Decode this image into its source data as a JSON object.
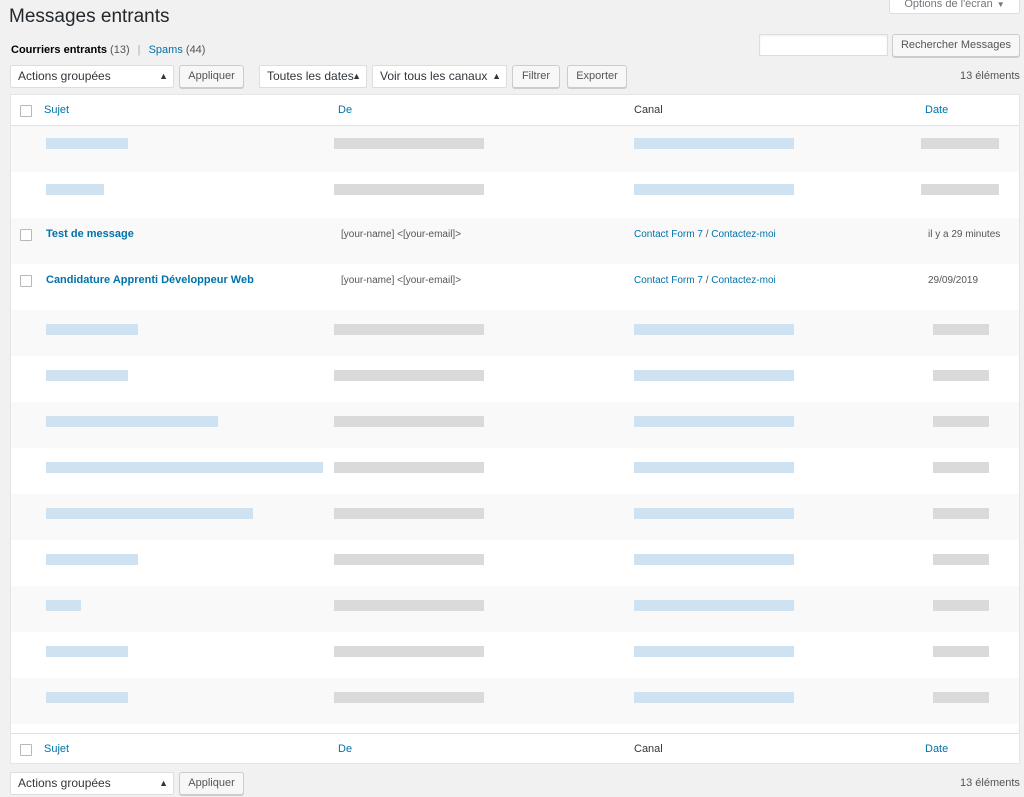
{
  "screen_options": {
    "label": "Options de l'écran"
  },
  "page_title": "Messages entrants",
  "views": {
    "inbox": {
      "label": "Courriers entrants",
      "count": "(13)"
    },
    "separator": "|",
    "spam": {
      "label": "Spams",
      "count": "(44)"
    }
  },
  "search": {
    "value": "",
    "button_label": "Rechercher Messages"
  },
  "top_nav": {
    "bulk_action": "Actions groupées",
    "apply_label": "Appliquer",
    "date_filter": "Toutes les dates",
    "channel_filter": "Voir tous les canaux",
    "filter_label": "Filtrer",
    "export_label": "Exporter",
    "items_count": "13 éléments"
  },
  "table": {
    "columns": {
      "subject": "Sujet",
      "from": "De",
      "channel": "Canal",
      "date": "Date"
    },
    "rows": [
      {
        "subject": "",
        "from": "",
        "channel_form": "",
        "channel_page": "",
        "date": "",
        "redacted": true
      },
      {
        "subject": "",
        "from": "",
        "channel_form": "",
        "channel_page": "",
        "date": "",
        "redacted": true
      },
      {
        "subject": "Test de message",
        "from": "[your-name] <[your-email]>",
        "channel_form": "Contact Form 7",
        "channel_sep": "/",
        "channel_page": "Contactez-moi",
        "date": "il y a 29 minutes",
        "redacted": false
      },
      {
        "subject": "Candidature Apprenti Développeur Web",
        "from": "[your-name] <[your-email]>",
        "channel_form": "Contact Form 7",
        "channel_sep": "/",
        "channel_page": "Contactez-moi",
        "date": "29/09/2019",
        "redacted": false
      },
      {
        "subject": "",
        "redacted": true
      },
      {
        "subject": "",
        "redacted": true
      },
      {
        "subject": "",
        "redacted": true
      },
      {
        "subject": "",
        "redacted": true
      },
      {
        "subject": "",
        "redacted": true
      },
      {
        "subject": "",
        "redacted": true
      },
      {
        "subject": "",
        "redacted": true
      },
      {
        "subject": "",
        "redacted": true
      },
      {
        "subject": "",
        "redacted": true
      }
    ]
  },
  "bottom_nav": {
    "bulk_action": "Actions groupées",
    "apply_label": "Appliquer",
    "items_count": "13 éléments"
  },
  "colors": {
    "link": "#0073aa",
    "background": "#f1f1f1",
    "text": "#23282d"
  }
}
